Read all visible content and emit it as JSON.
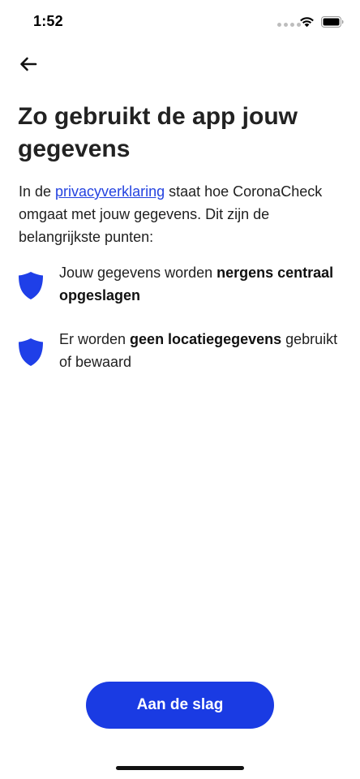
{
  "status_bar": {
    "time": "1:52",
    "signal_icon": "signal-dots-icon",
    "wifi_icon": "wifi-icon",
    "battery_icon": "battery-icon"
  },
  "nav": {
    "back_icon": "arrow-left-icon"
  },
  "title": "Zo gebruikt de app jouw gegevens",
  "intro": {
    "prefix": "In de ",
    "link": "privacyverklaring",
    "suffix": " staat hoe CoronaCheck omgaat met jouw gegevens. Dit zijn de belangrijkste punten:"
  },
  "points": [
    {
      "icon": "shield-icon",
      "text_before": "Jouw gegevens worden ",
      "text_bold": "nergens centraal opgeslagen",
      "text_after": ""
    },
    {
      "icon": "shield-icon",
      "text_before": "Er worden ",
      "text_bold": "geen locatiegegevens",
      "text_after": " gebruikt of bewaard"
    }
  ],
  "cta": {
    "label": "Aan de slag"
  },
  "colors": {
    "accent": "#1a3be3",
    "link": "#2443e0",
    "text": "#1f1f1f"
  }
}
